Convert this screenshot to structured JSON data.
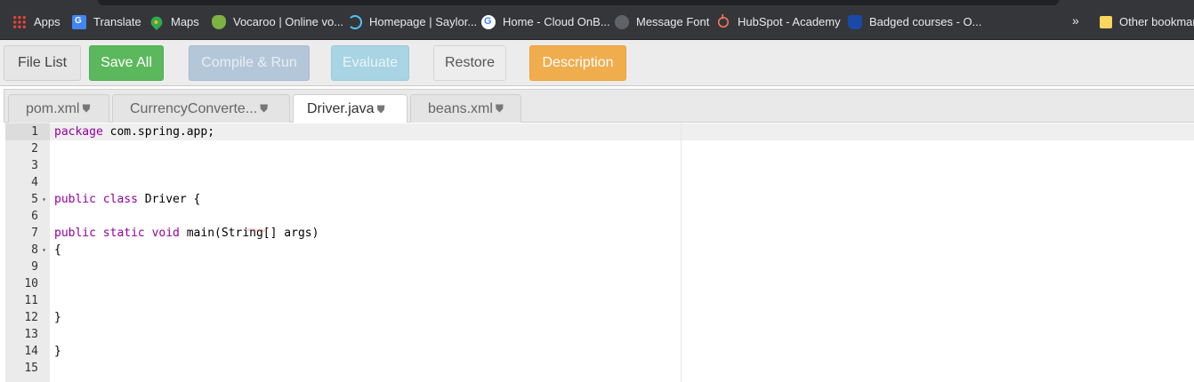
{
  "bookmarks": {
    "items": [
      {
        "label": "Apps",
        "icon": "apps-grid-icon"
      },
      {
        "label": "Translate",
        "icon": "google-translate-icon"
      },
      {
        "label": "Maps",
        "icon": "maps-pin-icon"
      },
      {
        "label": "Vocaroo | Online vo...",
        "icon": "vocaroo-icon"
      },
      {
        "label": "Homepage | Saylor...",
        "icon": "saylor-icon"
      },
      {
        "label": "Home - Cloud OnB...",
        "icon": "google-icon"
      },
      {
        "label": "Message Font",
        "icon": "globe-icon"
      },
      {
        "label": "HubSpot - Academy",
        "icon": "hubspot-icon"
      },
      {
        "label": "Badged courses - O...",
        "icon": "badged-icon"
      }
    ],
    "overflow": "»",
    "other": "Other bookmarks"
  },
  "toolbar": {
    "file_list": "File List",
    "save_all": "Save All",
    "compile_run": "Compile & Run",
    "evaluate": "Evaluate",
    "restore": "Restore",
    "description": "Description"
  },
  "tabs": [
    {
      "label": "pom.xml",
      "active": false
    },
    {
      "label": "CurrencyConverte...",
      "active": false
    },
    {
      "label": "Driver.java",
      "active": true
    },
    {
      "label": "beans.xml",
      "active": false
    }
  ],
  "editor": {
    "line_numbers": [
      "1",
      "2",
      "3",
      "4",
      "5",
      "6",
      "7",
      "8",
      "9",
      "10",
      "11",
      "12",
      "13",
      "14",
      "15"
    ],
    "fold_markers": [
      "5",
      "8"
    ],
    "lines": [
      {
        "kw": "package",
        "rest": " com.spring.app;"
      },
      {
        "kw": "",
        "rest": ""
      },
      {
        "kw": "",
        "rest": ""
      },
      {
        "kw": "",
        "rest": ""
      },
      {
        "kw": "public class",
        "rest": " Driver {"
      },
      {
        "kw": "",
        "rest": ""
      },
      {
        "kw": "public static void",
        "rest": " main(String[] args)"
      },
      {
        "kw": "",
        "rest": "{"
      },
      {
        "kw": "",
        "rest": ""
      },
      {
        "kw": "",
        "rest": ""
      },
      {
        "kw": "",
        "rest": ""
      },
      {
        "kw": "",
        "rest": "}"
      },
      {
        "kw": "",
        "rest": ""
      },
      {
        "kw": "",
        "rest": "}"
      },
      {
        "kw": "",
        "rest": ""
      }
    ]
  },
  "colors": {
    "save": "#5cb85c",
    "compile": "#b4c7d9",
    "evaluate": "#a8d4e3",
    "description": "#f0ad4e",
    "keyword": "#93009e"
  }
}
